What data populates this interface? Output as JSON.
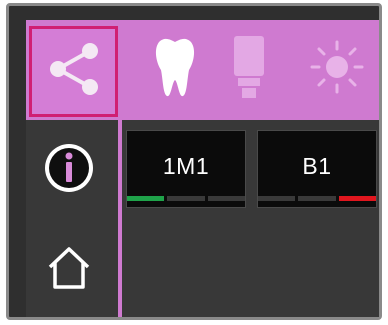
{
  "icons": {
    "share": "share-icon",
    "tooth": "tooth-icon",
    "lamp": "lamp-icon",
    "sun": "sun-icon",
    "info": "info-icon",
    "home": "home-icon"
  },
  "colors": {
    "accent": "#cf7ad0",
    "selected_border": "#d01f73",
    "bar_green": "#1fa34a",
    "bar_red": "#e0161e",
    "bar_gray": "#3a3a3a"
  },
  "shades": [
    {
      "label": "1M1",
      "bars": [
        "green",
        "gray",
        "gray"
      ]
    },
    {
      "label": "B1",
      "bars": [
        "gray",
        "gray",
        "red"
      ]
    }
  ]
}
